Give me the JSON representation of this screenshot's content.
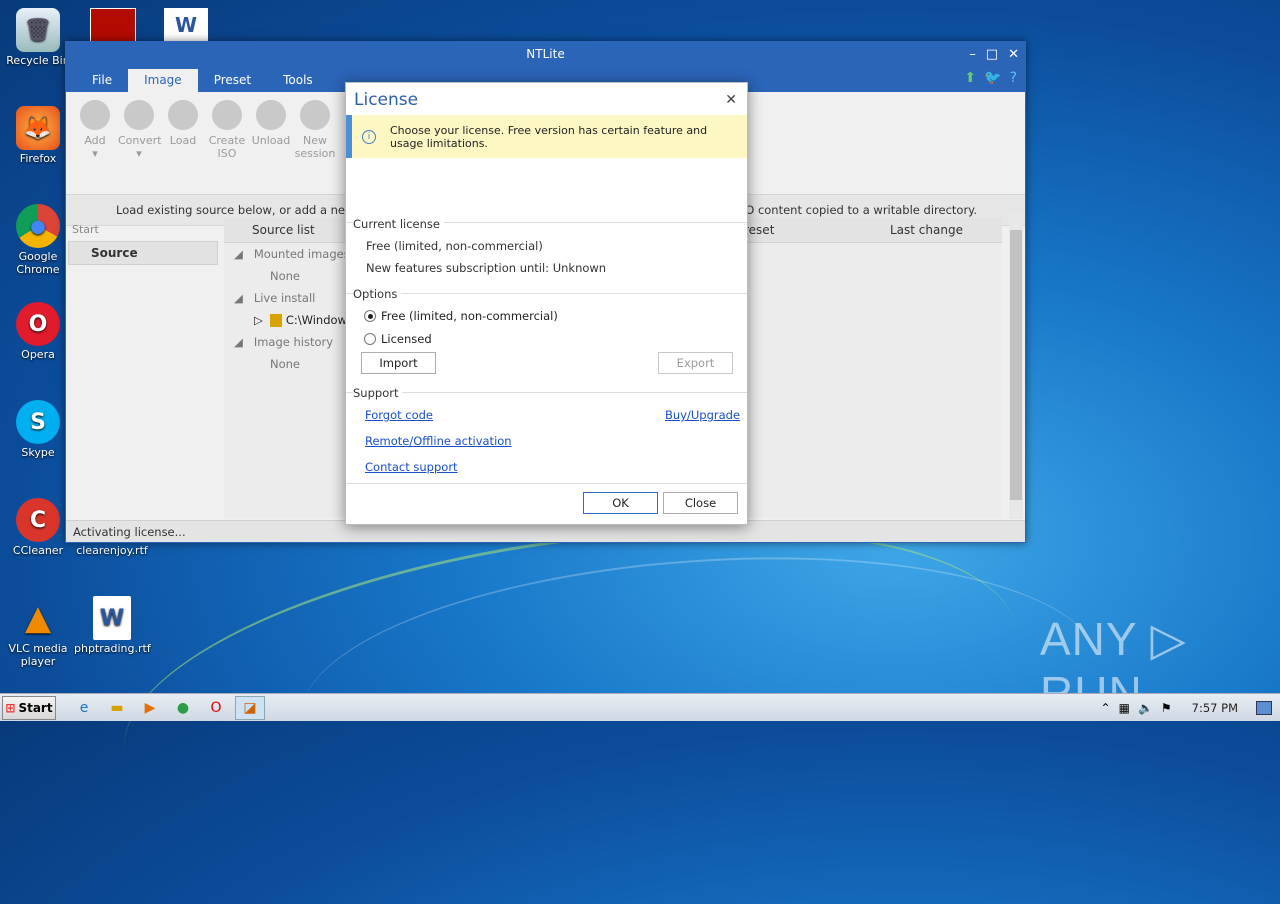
{
  "desktop": {
    "icons": [
      {
        "label": "Recycle Bin",
        "glyph": "🗑"
      },
      {
        "label": "Firefox",
        "glyph": "🦊"
      },
      {
        "label": "Google Chrome",
        "glyph": "◉"
      },
      {
        "label": "Opera",
        "glyph": "O"
      },
      {
        "label": "Skype",
        "glyph": "S"
      },
      {
        "label": "CCleaner",
        "glyph": "C"
      },
      {
        "label": "VLC media player",
        "glyph": "▲"
      },
      {
        "label": "clearenjoy.rtf",
        "glyph": "W"
      },
      {
        "label": "phptrading.rtf",
        "glyph": "W"
      }
    ],
    "watermark": "ANY ▷ RUN"
  },
  "window": {
    "title": "NTLite",
    "menu": [
      "File",
      "Image",
      "Preset",
      "Tools"
    ],
    "active_menu": "Image",
    "ribbon": [
      {
        "label": "Add",
        "sub": "▾"
      },
      {
        "label": "Convert",
        "sub": "▾"
      },
      {
        "label": "Load",
        "sub": ""
      },
      {
        "label": "Create",
        "sub": "ISO"
      },
      {
        "label": "Unload",
        "sub": ""
      },
      {
        "label": "New",
        "sub": "session"
      }
    ],
    "infobar_left": "Load existing source below, or add a new or",
    "infobar_right": "or ISO content copied to a writable directory.",
    "left_panel": {
      "header": "Start",
      "selected": "Source"
    },
    "columns": {
      "source_list": "Source list",
      "preset": "reset",
      "last_change": "Last change"
    },
    "tree": {
      "mounted": "Mounted images",
      "mounted_none": "None",
      "live": "Live install",
      "live_item": "C:\\Window",
      "history": "Image history",
      "history_none": "None"
    },
    "status": "Activating license..."
  },
  "dialog": {
    "title": "License",
    "notice": "Choose your license. Free version has certain feature and usage limitations.",
    "current_license_label": "Current license",
    "current_license_value": "Free (limited, non-commercial)",
    "subscription": "New features subscription until: Unknown",
    "options_label": "Options",
    "option_free": "Free (limited, non-commercial)",
    "option_licensed": "Licensed",
    "selected_option": "free",
    "import_label": "Import",
    "export_label": "Export",
    "support_label": "Support",
    "forgot_code": "Forgot code",
    "buy_upgrade": "Buy/Upgrade",
    "remote_activation": "Remote/Offline activation",
    "contact_support": "Contact support",
    "ok_label": "OK",
    "close_label": "Close"
  },
  "taskbar": {
    "start_label": "Start",
    "clock": "7:57 PM"
  }
}
